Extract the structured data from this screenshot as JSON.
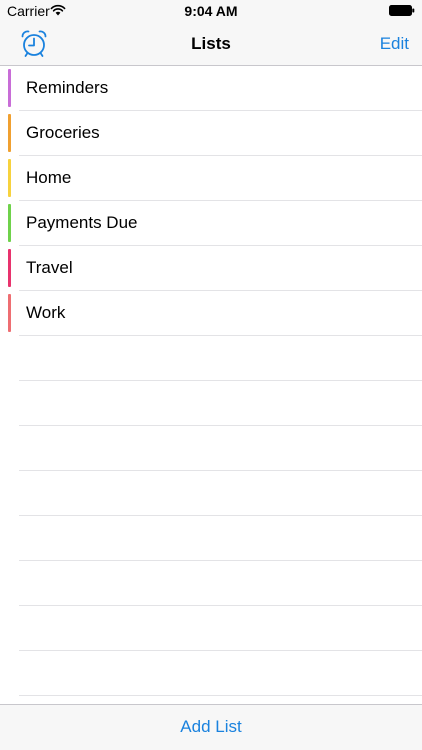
{
  "status_bar": {
    "carrier": "Carrier",
    "time": "9:04 AM",
    "wifi_icon": "wifi-icon",
    "battery_icon": "battery-icon"
  },
  "nav": {
    "title": "Lists",
    "left_icon": "alarm-clock-icon",
    "right_button": "Edit"
  },
  "lists": [
    {
      "label": "Reminders",
      "color": "#c86dd7"
    },
    {
      "label": "Groceries",
      "color": "#f0a030"
    },
    {
      "label": "Home",
      "color": "#f7d23e"
    },
    {
      "label": "Payments Due",
      "color": "#6fd24b"
    },
    {
      "label": "Travel",
      "color": "#e8336d"
    },
    {
      "label": "Work",
      "color": "#ee6e72"
    },
    {
      "label": "",
      "color": ""
    },
    {
      "label": "",
      "color": ""
    },
    {
      "label": "",
      "color": ""
    },
    {
      "label": "",
      "color": ""
    },
    {
      "label": "",
      "color": ""
    },
    {
      "label": "",
      "color": ""
    },
    {
      "label": "",
      "color": ""
    },
    {
      "label": "",
      "color": ""
    }
  ],
  "toolbar": {
    "add_label": "Add List"
  },
  "colors": {
    "accent": "#1a82de",
    "bar_background": "#f7f7f7",
    "separator": "#e3e3e6"
  }
}
